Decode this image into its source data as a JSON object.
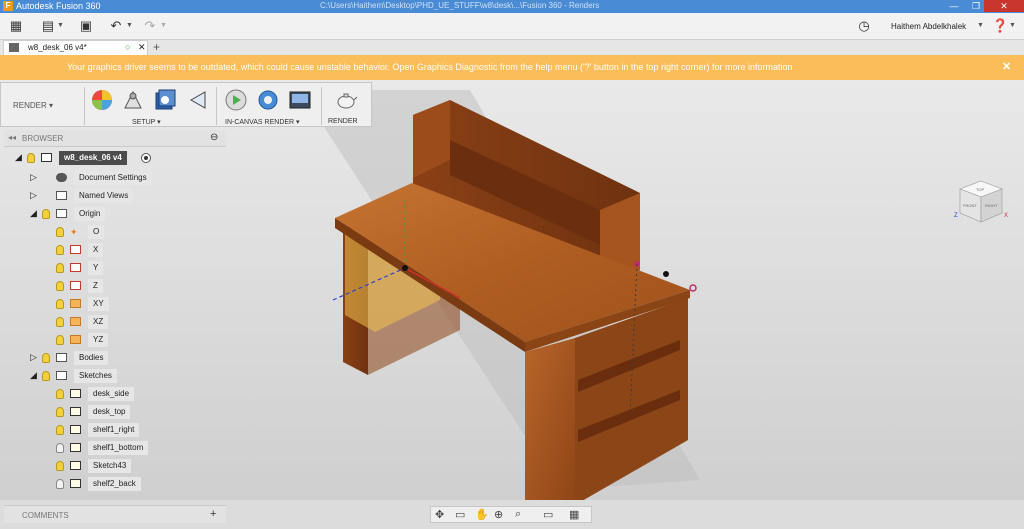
{
  "titlebar": {
    "app_title": "Autodesk Fusion 360",
    "path_text": "C:\\Users\\Haithem\\Desktop\\PHD_UE_STUFF\\w8\\desk\\...\\Fusion 360 - Renders",
    "min": "—",
    "max": "❐",
    "close": "✕"
  },
  "quickbar": {
    "grid_icon": "grid-icon",
    "file_icon": "file-icon",
    "save_icon": "save-icon",
    "undo_icon": "undo-icon",
    "redo_icon": "redo-icon",
    "clock_icon": "clock-icon",
    "user_name": "Haithem Abdelkhalek",
    "help_icon": "help-icon"
  },
  "tab": {
    "label": "w8_desk_06 v4*",
    "close": "✕",
    "add": "+"
  },
  "warning": {
    "message": "Your graphics driver seems to be outdated, which could cause unstable behavior. Open Graphics Diagnostic from the help menu ('?' button in the top right corner) for more information",
    "close": "✕",
    "color": "#fbbd59"
  },
  "toolbar": {
    "workspace": "RENDER",
    "groups": [
      {
        "label": "SETUP"
      },
      {
        "label": "IN-CANVAS RENDER"
      },
      {
        "label": "RENDER"
      }
    ],
    "icons": [
      "appearance-icon",
      "scene-settings-icon",
      "texture-map-icon",
      "decal-icon",
      "in-canvas-render-icon",
      "settings-icon",
      "capture-image-icon",
      "render-teapot-icon"
    ]
  },
  "browser": {
    "title": "BROWSER",
    "nodes": [
      {
        "label": "w8_desk_06 v4",
        "level": 0
      },
      {
        "label": "Document Settings",
        "level": 1
      },
      {
        "label": "Named Views",
        "level": 1
      },
      {
        "label": "Origin",
        "level": 1
      },
      {
        "label": "O",
        "level": 2
      },
      {
        "label": "X",
        "level": 2
      },
      {
        "label": "Y",
        "level": 2
      },
      {
        "label": "Z",
        "level": 2
      },
      {
        "label": "XY",
        "level": 2
      },
      {
        "label": "XZ",
        "level": 2
      },
      {
        "label": "YZ",
        "level": 2
      },
      {
        "label": "Bodies",
        "level": 1
      },
      {
        "label": "Sketches",
        "level": 1
      },
      {
        "label": "desk_side",
        "level": 2
      },
      {
        "label": "desk_top",
        "level": 2
      },
      {
        "label": "shelf1_right",
        "level": 2
      },
      {
        "label": "shelf1_bottom",
        "level": 2
      },
      {
        "label": "Sketch43",
        "level": 2
      },
      {
        "label": "shelf2_back",
        "level": 2
      }
    ]
  },
  "comments": {
    "title": "COMMENTS",
    "plus": "+"
  },
  "viewcube": {
    "top": "TOP",
    "front": "FRONT",
    "right": "RIGHT"
  },
  "colors": {
    "wood": "#a4561f",
    "wood_dark": "#7a3b12",
    "accent": "#4a8bd6"
  }
}
